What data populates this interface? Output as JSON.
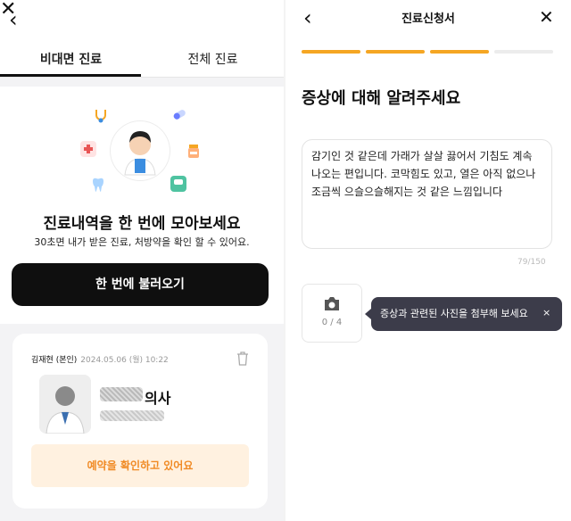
{
  "left": {
    "back_icon": "chevron-left-icon",
    "tabs": [
      {
        "label": "비대면 진료",
        "active": true
      },
      {
        "label": "전체 진료",
        "active": false
      }
    ],
    "promo": {
      "title": "진료내역을 한 번에 모아보세요",
      "subtitle": "30초면 내가 받은 진료, 처방약을 확인 할 수 있어요.",
      "cta": "한 번에 불러오기"
    },
    "card": {
      "patient": "김재현 (본인)",
      "datetime": "2024.05.06 (월) 10:22",
      "doctor_suffix": "의사",
      "status": "예약을 확인하고 있어요"
    }
  },
  "right": {
    "title": "진료신청서",
    "progress": {
      "total": 4,
      "done": 3
    },
    "heading": "증상에 대해 알려주세요",
    "symptom_text": "감기인 것 같은데 가래가 살살 끓어서 기침도 계속\n나오는 편입니다. 코막힘도 있고, 열은 아직 없으나\n조금씩 으슬으슬해지는 것 같은 느낌입니다",
    "char_count": "79/150",
    "photo_count": "0 / 4",
    "tooltip": "증상과 관련된 사진을 첨부해 보세요",
    "tooltip_close": "×"
  },
  "colors": {
    "accent_orange": "#f5a623",
    "status_text": "#f08a24",
    "status_bg": "#fff1e0",
    "cta_bg": "#0f0f0f",
    "tooltip_bg": "#3c3c4a"
  }
}
